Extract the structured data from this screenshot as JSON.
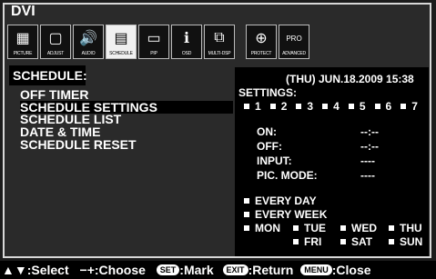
{
  "title": "DVI",
  "icons": [
    {
      "name": "picture",
      "label": "PICTURE",
      "glyph": "▦"
    },
    {
      "name": "adjust",
      "label": "ADJUST",
      "glyph": "▢"
    },
    {
      "name": "audio",
      "label": "AUDIO",
      "glyph": "🔊"
    },
    {
      "name": "schedule",
      "label": "SCHEDULE",
      "glyph": "▤"
    },
    {
      "name": "pip",
      "label": "PIP",
      "glyph": "▭"
    },
    {
      "name": "osd",
      "label": "OSD",
      "glyph": "ℹ"
    },
    {
      "name": "multidsp",
      "label": "MULTI-DSP",
      "glyph": "⧉"
    },
    {
      "name": "protect",
      "label": "PROTECT",
      "glyph": "⊕"
    },
    {
      "name": "advanced",
      "label": "ADVANCED",
      "glyph": "PRO"
    }
  ],
  "menu": {
    "header": "SCHEDULE:",
    "items": [
      "OFF TIMER",
      "SCHEDULE SETTINGS",
      "SCHEDULE LIST",
      "DATE & TIME",
      "SCHEDULE RESET"
    ]
  },
  "right": {
    "datetime": "(THU) JUN.18.2009 15:38",
    "settings_label": "SETTINGS:",
    "slots": [
      "1",
      "2",
      "3",
      "4",
      "5",
      "6",
      "7"
    ],
    "on_label": "ON:",
    "on_value": "--:--",
    "off_label": "OFF:",
    "off_value": "--:--",
    "input_label": "INPUT:",
    "input_value": "----",
    "pic_mode_label": "PIC. MODE:",
    "pic_mode_value": "----",
    "every_day": "EVERY DAY",
    "every_week": "EVERY WEEK",
    "days": [
      "MON",
      "TUE",
      "WED",
      "THU",
      "FRI",
      "SAT",
      "SUN"
    ]
  },
  "bottom": {
    "select_keys": "▲▼",
    "select_label": ":Select",
    "choose_keys": "−+",
    "choose_label": ":Choose",
    "set_key": "SET",
    "mark_label": ":Mark",
    "exit_key": "EXIT",
    "return_label": ":Return",
    "menu_key": "MENU",
    "close_label": ":Close"
  }
}
